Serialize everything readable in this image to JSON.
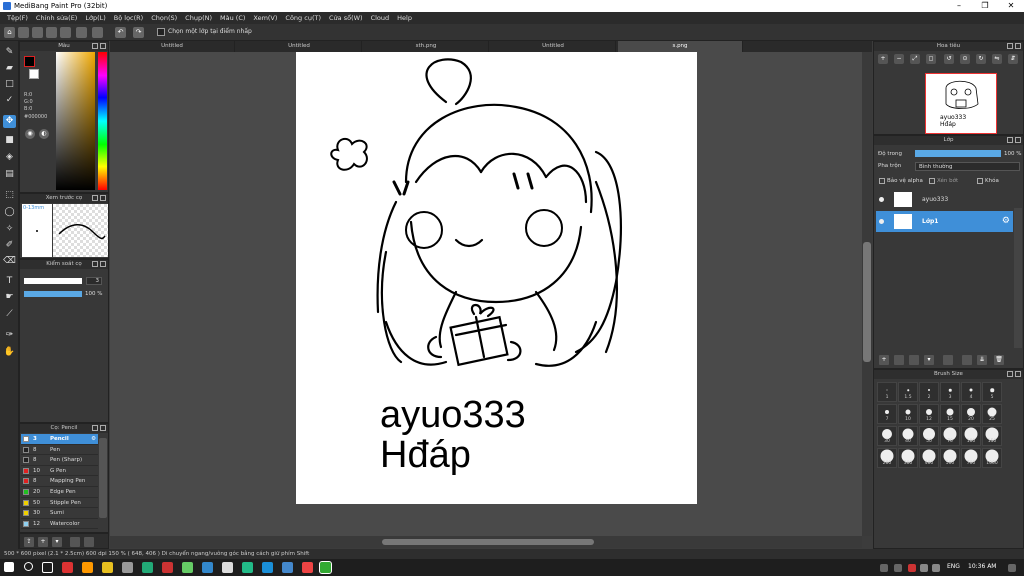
{
  "window": {
    "title": "MediBang Paint Pro (32bit)",
    "min": "–",
    "max": "❐",
    "close": "✕"
  },
  "menu": [
    "Tệp(F)",
    "Chỉnh sửa(E)",
    "Lớp(L)",
    "Bộ lọc(R)",
    "Chọn(S)",
    "Chụp(N)",
    "Màu (C)",
    "Xem(V)",
    "Công cụ(T)",
    "Cửa sổ(W)",
    "Cloud",
    "Help"
  ],
  "toolbar": {
    "checkbox_label": "Chọn một lớp tại điểm nhấp"
  },
  "color_panel": {
    "title": "Màu",
    "r": "R:0",
    "g": "G:0",
    "b": "B:0",
    "hex": "#000000"
  },
  "preview_panel": {
    "title": "Xem trước cọ",
    "size": "0-13mm"
  },
  "control_panel": {
    "title": "Kiểm soát cọ",
    "size_value": "3",
    "opacity_value": "100",
    "opacity_unit": "%"
  },
  "brush_panel": {
    "title": "Cọ: Pencil",
    "brushes": [
      {
        "size": "3",
        "name": "Pencil",
        "color": "#ffffff",
        "selected": true
      },
      {
        "size": "8",
        "name": "Pen",
        "color": "#222222"
      },
      {
        "size": "8",
        "name": "Pen (Sharp)",
        "color": "#222222"
      },
      {
        "size": "10",
        "name": "G Pen",
        "color": "#e02020"
      },
      {
        "size": "8",
        "name": "Mapping Pen",
        "color": "#e02020"
      },
      {
        "size": "20",
        "name": "Edge Pen",
        "color": "#20c020"
      },
      {
        "size": "50",
        "name": "Stipple Pen",
        "color": "#f0d000"
      },
      {
        "size": "30",
        "name": "Sumi",
        "color": "#f0d000"
      },
      {
        "size": "12",
        "name": "Watercolor",
        "color": "#90d0f0"
      }
    ]
  },
  "tabs": [
    {
      "label": "Untitled"
    },
    {
      "label": "Untitled"
    },
    {
      "label": "sth.png"
    },
    {
      "label": "Untitled"
    },
    {
      "label": "s.png",
      "active": true
    }
  ],
  "canvas": {
    "text_line1": "ayuo333",
    "text_line2": "Hđáp"
  },
  "navigator": {
    "title": "Hoa tiêu",
    "thumb_text1": "ayuo333",
    "thumb_text2": "Hđáp"
  },
  "layer_panel": {
    "title": "Lớp",
    "opacity_label": "Độ trong",
    "opacity_value": "100 %",
    "blend_label": "Pha trộn",
    "blend_value": "Bình thường",
    "protect_alpha": "Bảo vệ alpha",
    "clipping": "Xén bớt",
    "lock": "Khóa",
    "layers": [
      {
        "name": "ayuo333"
      },
      {
        "name": "Lớp1",
        "selected": true
      }
    ]
  },
  "brush_size": {
    "title": "Brush Size",
    "sizes": [
      "1",
      "1.5",
      "2",
      "3",
      "4",
      "5",
      "7",
      "10",
      "12",
      "15",
      "20",
      "25",
      "30",
      "40",
      "50",
      "70",
      "100",
      "150",
      "200",
      "300",
      "400",
      "500",
      "700",
      "1000"
    ]
  },
  "status": {
    "text": "500 * 600 pixel   (2.1 * 2.5cm)   600 dpi   150 %   ( 648, 406 )   Di chuyển ngang/vuông góc bằng cách giữ phím Shift"
  },
  "taskbar": {
    "lang": "ENG",
    "time": "10:36 AM"
  },
  "colors": {
    "accent": "#3f8fd8",
    "panel": "#383838",
    "canvas_bg": "#4a4a4a"
  }
}
